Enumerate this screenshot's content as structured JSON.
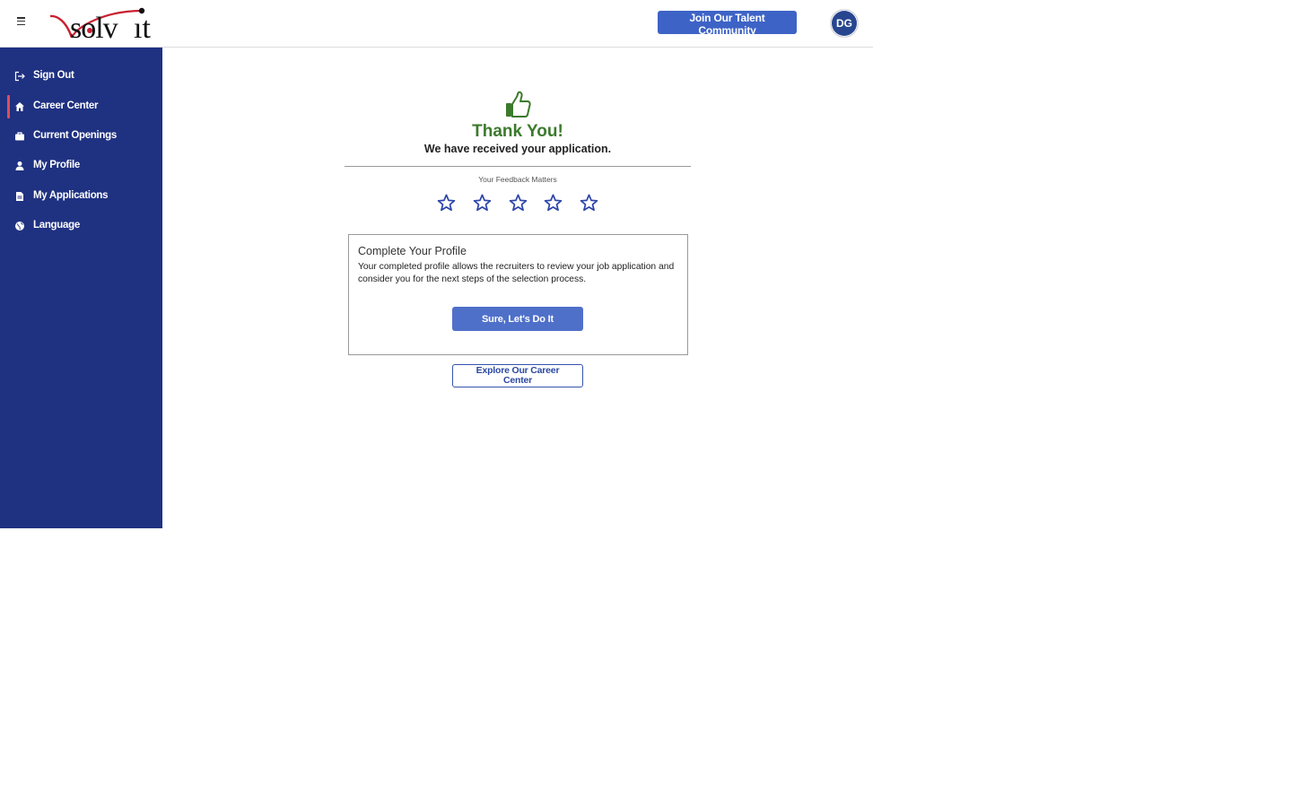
{
  "header": {
    "logo_text": "vsolvit",
    "talent_button": "Join Our Talent Community",
    "avatar_initials": "DG"
  },
  "sidebar": {
    "items": [
      {
        "label": "Sign Out",
        "icon": "sign-out-icon"
      },
      {
        "label": "Career Center",
        "icon": "home-icon",
        "active": true
      },
      {
        "label": "Current Openings",
        "icon": "briefcase-icon"
      },
      {
        "label": "My Profile",
        "icon": "person-icon"
      },
      {
        "label": "My Applications",
        "icon": "document-icon"
      },
      {
        "label": "Language",
        "icon": "globe-icon"
      }
    ]
  },
  "main": {
    "thank_you": "Thank You!",
    "received": "We have received your application.",
    "feedback_label": "Your Feedback Matters",
    "rating": {
      "max": 5,
      "value": 0
    },
    "card": {
      "title": "Complete Your Profile",
      "body": "Your completed profile allows the recruiters to review your job application and consider you for the next steps of the selection process.",
      "button": "Sure, Let's Do It"
    },
    "explore_button": "Explore Our Career Center"
  },
  "colors": {
    "sidebar_bg": "#1f3181",
    "primary_button": "#3d63c6",
    "success_green": "#3c7a2d",
    "active_indicator": "#d9505d",
    "star_outline": "#2d45a8"
  }
}
